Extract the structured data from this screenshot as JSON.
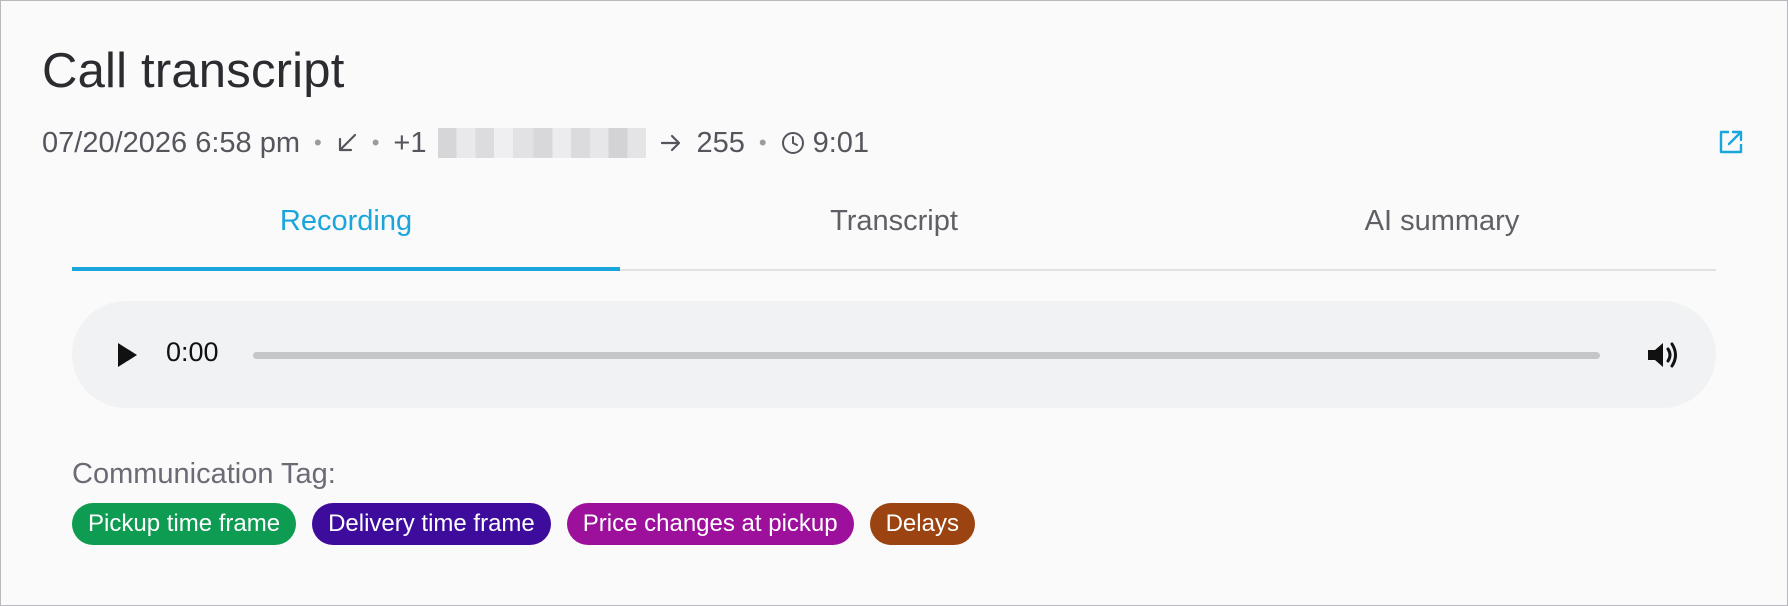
{
  "header": {
    "title": "Call transcript",
    "datetime": "07/20/2026 6:58 pm",
    "direction_icon": "incoming-call-arrow-icon",
    "phone_prefix": "+1",
    "extension": "255",
    "duration": "9:01",
    "open_external_icon": "external-link-icon"
  },
  "tabs": [
    {
      "label": "Recording",
      "active": true
    },
    {
      "label": "Transcript",
      "active": false
    },
    {
      "label": "AI summary",
      "active": false
    }
  ],
  "player": {
    "current_time": "0:00",
    "progress": 0,
    "play_icon": "play-icon",
    "volume_icon": "volume-icon"
  },
  "communication": {
    "label": "Communication Tag:",
    "tags": [
      {
        "label": "Pickup time frame",
        "color": "#0e9c52"
      },
      {
        "label": "Delivery time frame",
        "color": "#3d0c9c"
      },
      {
        "label": "Price changes at pickup",
        "color": "#9c109c"
      },
      {
        "label": "Delays",
        "color": "#9c4312"
      }
    ]
  },
  "colors": {
    "accent": "#1aa6dc",
    "text_primary": "#2b2b30",
    "text_secondary": "#55565d"
  }
}
